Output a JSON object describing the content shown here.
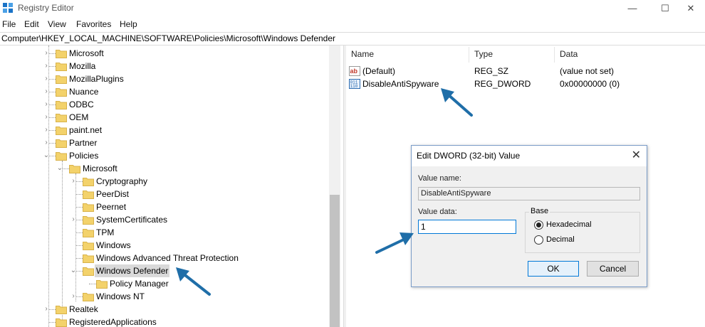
{
  "window": {
    "title": "Registry Editor",
    "controls": {
      "minimize": "—",
      "maximize": "☐",
      "close": "✕"
    }
  },
  "menu": [
    "File",
    "Edit",
    "View",
    "Favorites",
    "Help"
  ],
  "address": "Computer\\HKEY_LOCAL_MACHINE\\SOFTWARE\\Policies\\Microsoft\\Windows Defender",
  "tree": [
    {
      "label": "Microsoft",
      "expander": "›"
    },
    {
      "label": "Mozilla",
      "expander": "›"
    },
    {
      "label": "MozillaPlugins",
      "expander": "›"
    },
    {
      "label": "Nuance",
      "expander": "›"
    },
    {
      "label": "ODBC",
      "expander": "›"
    },
    {
      "label": "OEM",
      "expander": "›"
    },
    {
      "label": "paint.net",
      "expander": "›"
    },
    {
      "label": "Partner",
      "expander": "›"
    },
    {
      "label": "Policies",
      "expander": "⌄"
    },
    {
      "label": "Microsoft",
      "expander": "⌄"
    },
    {
      "label": "Cryptography",
      "expander": "›"
    },
    {
      "label": "PeerDist",
      "expander": ""
    },
    {
      "label": "Peernet",
      "expander": ""
    },
    {
      "label": "SystemCertificates",
      "expander": "›"
    },
    {
      "label": "TPM",
      "expander": ""
    },
    {
      "label": "Windows",
      "expander": ""
    },
    {
      "label": "Windows Advanced Threat Protection",
      "expander": ""
    },
    {
      "label": "Windows Defender",
      "expander": "⌄",
      "selected": true
    },
    {
      "label": "Policy Manager",
      "expander": ""
    },
    {
      "label": "Windows NT",
      "expander": "›"
    },
    {
      "label": "Realtek",
      "expander": "›"
    },
    {
      "label": "RegisteredApplications",
      "expander": ""
    }
  ],
  "list": {
    "columns": [
      "Name",
      "Type",
      "Data"
    ],
    "rows": [
      {
        "icon": "string-value-icon",
        "name": "(Default)",
        "type": "REG_SZ",
        "data": "(value not set)"
      },
      {
        "icon": "dword-value-icon",
        "name": "DisableAntiSpyware",
        "type": "REG_DWORD",
        "data": "0x00000000 (0)"
      }
    ]
  },
  "dialog": {
    "title": "Edit DWORD (32-bit) Value",
    "close": "✕",
    "value_name_label": "Value name:",
    "value_name": "DisableAntiSpyware",
    "value_data_label": "Value data:",
    "value_data": "1",
    "base_label": "Base",
    "radio_hex": "Hexadecimal",
    "radio_dec": "Decimal",
    "selected_base": "Hexadecimal",
    "ok": "OK",
    "cancel": "Cancel"
  },
  "colors": {
    "arrow": "#1f6ea8",
    "folder": "#f3d26b",
    "selection": "#d9d9d9"
  }
}
